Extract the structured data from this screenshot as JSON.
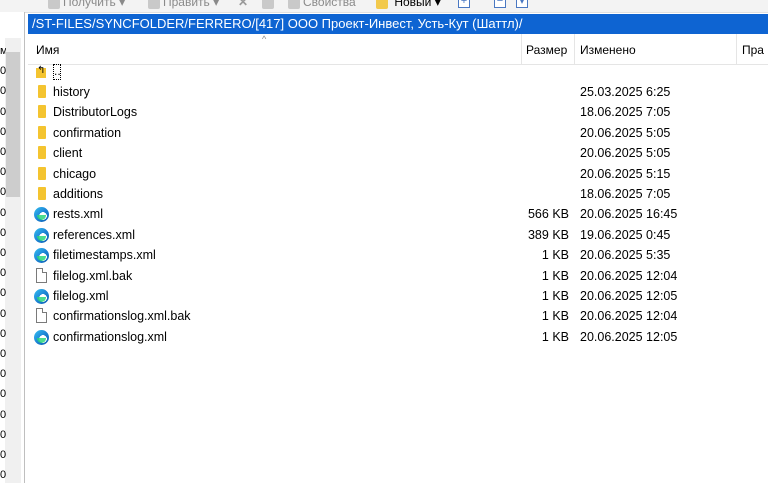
{
  "toolbar": {
    "get_label": "Получить",
    "edit_label": "Править",
    "props_label": "Свойства",
    "new_label": "Новый"
  },
  "path": "/ST-FILES/SYNCFOLDER/FERRERO/[417] ООО Проект-Инвест, Усть-Кут (Шаттл)/",
  "columns": {
    "name": "Имя",
    "size": "Размер",
    "modified": "Изменено",
    "rights": "Пра"
  },
  "up_dir": "..",
  "rows": [
    {
      "name": "history",
      "size": "",
      "modified": "25.03.2025 6:25",
      "icon": "folder-icon"
    },
    {
      "name": "DistributorLogs",
      "size": "",
      "modified": "18.06.2025 7:05",
      "icon": "folder-icon"
    },
    {
      "name": "confirmation",
      "size": "",
      "modified": "20.06.2025 5:05",
      "icon": "folder-icon"
    },
    {
      "name": "client",
      "size": "",
      "modified": "20.06.2025 5:05",
      "icon": "folder-icon"
    },
    {
      "name": "chicago",
      "size": "",
      "modified": "20.06.2025 5:15",
      "icon": "folder-icon"
    },
    {
      "name": "additions",
      "size": "",
      "modified": "18.06.2025 7:05",
      "icon": "folder-icon"
    },
    {
      "name": "rests.xml",
      "size": "566 KB",
      "modified": "20.06.2025 16:45",
      "icon": "edge-xml-icon"
    },
    {
      "name": "references.xml",
      "size": "389 KB",
      "modified": "19.06.2025 0:45",
      "icon": "edge-xml-icon"
    },
    {
      "name": "filetimestamps.xml",
      "size": "1 KB",
      "modified": "20.06.2025 5:35",
      "icon": "edge-xml-icon"
    },
    {
      "name": "filelog.xml.bak",
      "size": "1 KB",
      "modified": "20.06.2025 12:04",
      "icon": "document-icon"
    },
    {
      "name": "filelog.xml",
      "size": "1 KB",
      "modified": "20.06.2025 12:05",
      "icon": "edge-xml-icon"
    },
    {
      "name": "confirmationslog.xml.bak",
      "size": "1 KB",
      "modified": "20.06.2025 12:04",
      "icon": "document-icon"
    },
    {
      "name": "confirmationslog.xml",
      "size": "1 KB",
      "modified": "20.06.2025 12:05",
      "icon": "edge-xml-icon"
    }
  ],
  "left_pane_chars": [
    "м",
    "0",
    "0",
    "0",
    "0",
    "0",
    "0",
    "0",
    "0",
    "0",
    "0",
    "0",
    "0",
    "0",
    "0",
    "0",
    "0",
    "0",
    "0",
    "0",
    "0",
    "0"
  ]
}
